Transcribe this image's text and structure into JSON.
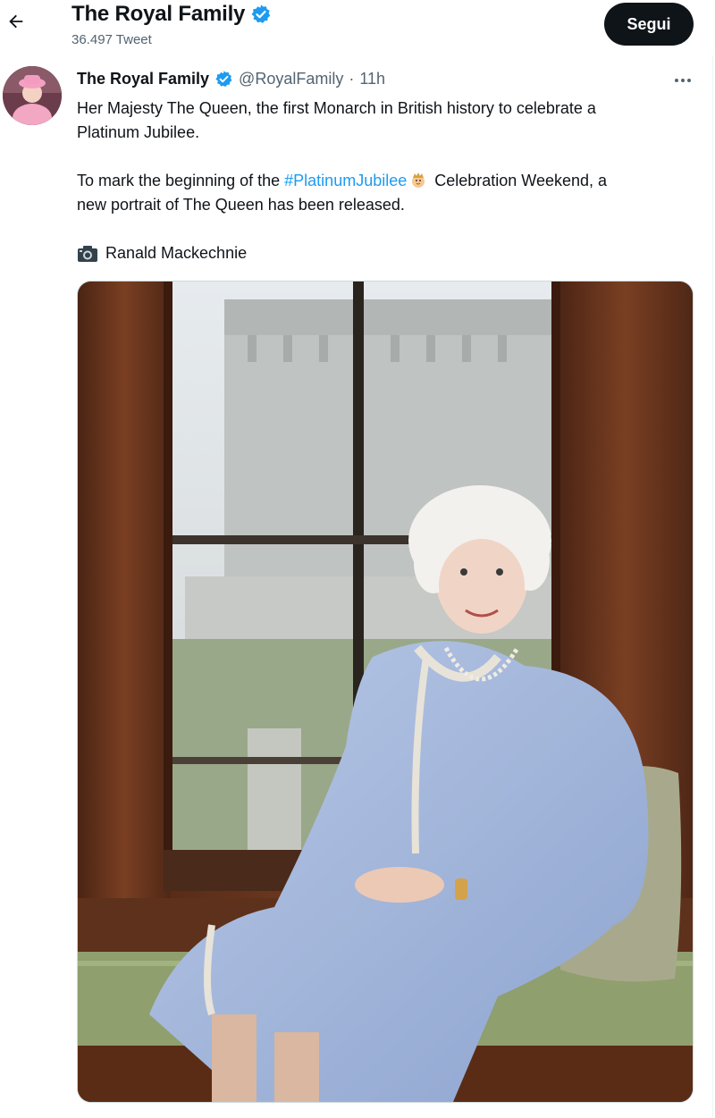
{
  "header": {
    "title": "The Royal Family",
    "subtitle": "36.497 Tweet",
    "follow_label": "Segui"
  },
  "tweet": {
    "display_name": "The Royal Family",
    "handle": "@RoyalFamily",
    "separator": "·",
    "time": "11h",
    "line1": "Her Majesty The Queen, the first Monarch in British history to celebrate a",
    "line2": "Platinum Jubilee.",
    "line3_pre": "To mark the beginning of the ",
    "hashtag": "#PlatinumJubilee",
    "line3_post": " Celebration Weekend, a",
    "line4": "new portrait of The Queen has been released.",
    "credit": "Ranald Mackechnie"
  },
  "colors": {
    "accent": "#1d9bf0",
    "verified": "#1d9bf0",
    "follow_bg": "#0f1419"
  },
  "icons": {
    "back": "arrow-left-icon",
    "verified": "verified-badge-icon",
    "more": "more-horizontal-icon",
    "camera": "camera-icon",
    "hashflag": "crown-emoji-icon"
  }
}
